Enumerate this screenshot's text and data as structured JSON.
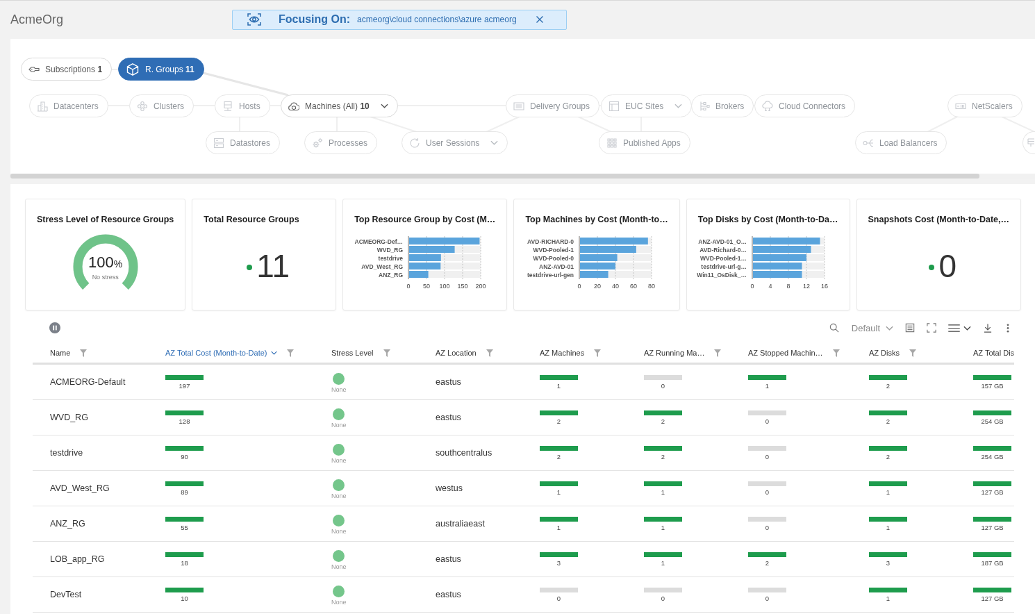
{
  "app": {
    "title": "AcmeOrg"
  },
  "focus_banner": {
    "label": "Focusing On:",
    "path": "acmeorg\\cloud connections\\azure acmeorg"
  },
  "navigator": {
    "nodes": [
      {
        "label": "Subscriptions",
        "count": "1",
        "selected": false,
        "disabled": false,
        "dropdown": false
      },
      {
        "label": "R. Groups",
        "count": "11",
        "selected": true,
        "disabled": false,
        "dropdown": false
      },
      {
        "label": "Datacenters",
        "selected": false,
        "disabled": true,
        "dropdown": false
      },
      {
        "label": "Clusters",
        "selected": false,
        "disabled": true,
        "dropdown": false
      },
      {
        "label": "Hosts",
        "selected": false,
        "disabled": true,
        "dropdown": false
      },
      {
        "label": "Machines (All)",
        "count": "10",
        "selected": false,
        "disabled": false,
        "dropdown": true
      },
      {
        "label": "Delivery Groups",
        "selected": false,
        "disabled": true,
        "dropdown": false
      },
      {
        "label": "EUC Sites",
        "selected": false,
        "disabled": true,
        "dropdown": true
      },
      {
        "label": "Brokers",
        "selected": false,
        "disabled": true,
        "dropdown": false
      },
      {
        "label": "Cloud Connectors",
        "selected": false,
        "disabled": true,
        "dropdown": false
      },
      {
        "label": "NetScalers",
        "selected": false,
        "disabled": true,
        "dropdown": false
      },
      {
        "label": "Datastores",
        "selected": false,
        "disabled": true,
        "dropdown": false
      },
      {
        "label": "Processes",
        "selected": false,
        "disabled": true,
        "dropdown": false
      },
      {
        "label": "User Sessions",
        "selected": false,
        "disabled": true,
        "dropdown": true
      },
      {
        "label": "Published Apps",
        "selected": false,
        "disabled": true,
        "dropdown": false
      },
      {
        "label": "Load Balancers",
        "selected": false,
        "disabled": true,
        "dropdown": false
      }
    ]
  },
  "kpi_cards": [
    {
      "kind": "gauge",
      "title": "Stress Level of Resource Groups",
      "value": "100",
      "unit": "%",
      "caption": "No stress"
    },
    {
      "kind": "number",
      "title": "Total Resource Groups",
      "value": "11"
    },
    {
      "kind": "chart",
      "title": "Top Resource Group by Cost (M…",
      "chart_data": {
        "type": "bar",
        "orientation": "horizontal",
        "grid": true,
        "categories": [
          "ACMEORG-Def…",
          "WVD_RG",
          "testdrive",
          "AVD_West_RG",
          "ANZ_RG"
        ],
        "values": [
          197,
          128,
          90,
          89,
          55
        ],
        "xlim": [
          0,
          200
        ],
        "xticks": [
          0,
          50,
          100,
          150,
          200
        ]
      }
    },
    {
      "kind": "chart",
      "title": "Top Machines by Cost (Month-to…",
      "chart_data": {
        "type": "bar",
        "orientation": "horizontal",
        "grid": true,
        "categories": [
          "AVD-RICHARD-0",
          "WVD-Pooled-1",
          "WVD-Pooled-0",
          "ANZ-AVD-01",
          "testdrive-url-gen"
        ],
        "values": [
          76,
          63,
          42,
          40,
          32
        ],
        "xlim": [
          0,
          80
        ],
        "xticks": [
          0,
          20,
          40,
          60,
          80
        ]
      }
    },
    {
      "kind": "chart",
      "title": "Top Disks by Cost (Month-to-Da…",
      "chart_data": {
        "type": "bar",
        "orientation": "horizontal",
        "grid": true,
        "categories": [
          "ANZ-AVD-01_O…",
          "AVD-Richard-0…",
          "WVD-Pooled-1…",
          "testdrive-url-g…",
          "Win11_OsDisk_…"
        ],
        "values": [
          15,
          13,
          12,
          11,
          11
        ],
        "xlim": [
          0,
          16
        ],
        "xticks": [
          0,
          4,
          8,
          12,
          16
        ]
      }
    },
    {
      "kind": "number",
      "title": "Snapshots Cost (Month-to-Date,…",
      "value": "0"
    }
  ],
  "table_toolbar": {
    "view": "Default"
  },
  "table": {
    "columns": [
      {
        "label": "Name",
        "sorted": false
      },
      {
        "label": "AZ Total Cost (Month-to-Date)",
        "sorted": true
      },
      {
        "label": "Stress Level",
        "sorted": false
      },
      {
        "label": "AZ Location",
        "sorted": false
      },
      {
        "label": "AZ Machines",
        "sorted": false
      },
      {
        "label": "AZ Running Ma…",
        "sorted": false
      },
      {
        "label": "AZ Stopped Machin…",
        "sorted": false
      },
      {
        "label": "AZ Disks",
        "sorted": false
      },
      {
        "label": "AZ Total Dis",
        "sorted": false
      }
    ],
    "rows": [
      {
        "cells": [
          {
            "kind": "text",
            "value": "ACMEORG-Default"
          },
          {
            "kind": "bar",
            "value": "197",
            "color": "#1e9c4d"
          },
          {
            "kind": "status",
            "label": "None",
            "color": "#74c68b"
          },
          {
            "kind": "text",
            "value": "eastus"
          },
          {
            "kind": "bar",
            "value": "1",
            "color": "#1e9c4d"
          },
          {
            "kind": "bar",
            "value": "0",
            "color": "#dcdcdc"
          },
          {
            "kind": "bar",
            "value": "1",
            "color": "#1e9c4d"
          },
          {
            "kind": "bar",
            "value": "2",
            "color": "#1e9c4d"
          },
          {
            "kind": "bar",
            "value": "157 GB",
            "color": "#1e9c4d"
          }
        ]
      },
      {
        "cells": [
          {
            "kind": "text",
            "value": "WVD_RG"
          },
          {
            "kind": "bar",
            "value": "128",
            "color": "#1e9c4d"
          },
          {
            "kind": "status",
            "label": "None",
            "color": "#74c68b"
          },
          {
            "kind": "text",
            "value": "eastus"
          },
          {
            "kind": "bar",
            "value": "2",
            "color": "#1e9c4d"
          },
          {
            "kind": "bar",
            "value": "2",
            "color": "#1e9c4d"
          },
          {
            "kind": "bar",
            "value": "0",
            "color": "#dcdcdc"
          },
          {
            "kind": "bar",
            "value": "2",
            "color": "#1e9c4d"
          },
          {
            "kind": "bar",
            "value": "254 GB",
            "color": "#1e9c4d"
          }
        ]
      },
      {
        "cells": [
          {
            "kind": "text",
            "value": "testdrive"
          },
          {
            "kind": "bar",
            "value": "90",
            "color": "#1e9c4d"
          },
          {
            "kind": "status",
            "label": "None",
            "color": "#74c68b"
          },
          {
            "kind": "text",
            "value": "southcentralus"
          },
          {
            "kind": "bar",
            "value": "2",
            "color": "#1e9c4d"
          },
          {
            "kind": "bar",
            "value": "2",
            "color": "#1e9c4d"
          },
          {
            "kind": "bar",
            "value": "0",
            "color": "#dcdcdc"
          },
          {
            "kind": "bar",
            "value": "2",
            "color": "#1e9c4d"
          },
          {
            "kind": "bar",
            "value": "254 GB",
            "color": "#1e9c4d"
          }
        ]
      },
      {
        "cells": [
          {
            "kind": "text",
            "value": "AVD_West_RG"
          },
          {
            "kind": "bar",
            "value": "89",
            "color": "#1e9c4d"
          },
          {
            "kind": "status",
            "label": "None",
            "color": "#74c68b"
          },
          {
            "kind": "text",
            "value": "westus"
          },
          {
            "kind": "bar",
            "value": "1",
            "color": "#1e9c4d"
          },
          {
            "kind": "bar",
            "value": "1",
            "color": "#1e9c4d"
          },
          {
            "kind": "bar",
            "value": "0",
            "color": "#dcdcdc"
          },
          {
            "kind": "bar",
            "value": "1",
            "color": "#1e9c4d"
          },
          {
            "kind": "bar",
            "value": "127 GB",
            "color": "#1e9c4d"
          }
        ]
      },
      {
        "cells": [
          {
            "kind": "text",
            "value": "ANZ_RG"
          },
          {
            "kind": "bar",
            "value": "55",
            "color": "#1e9c4d"
          },
          {
            "kind": "status",
            "label": "None",
            "color": "#74c68b"
          },
          {
            "kind": "text",
            "value": "australiaeast"
          },
          {
            "kind": "bar",
            "value": "1",
            "color": "#1e9c4d"
          },
          {
            "kind": "bar",
            "value": "1",
            "color": "#1e9c4d"
          },
          {
            "kind": "bar",
            "value": "0",
            "color": "#dcdcdc"
          },
          {
            "kind": "bar",
            "value": "1",
            "color": "#1e9c4d"
          },
          {
            "kind": "bar",
            "value": "127 GB",
            "color": "#1e9c4d"
          }
        ]
      },
      {
        "cells": [
          {
            "kind": "text",
            "value": "LOB_app_RG"
          },
          {
            "kind": "bar",
            "value": "18",
            "color": "#1e9c4d"
          },
          {
            "kind": "status",
            "label": "None",
            "color": "#74c68b"
          },
          {
            "kind": "text",
            "value": "eastus"
          },
          {
            "kind": "bar",
            "value": "3",
            "color": "#1e9c4d"
          },
          {
            "kind": "bar",
            "value": "1",
            "color": "#1e9c4d"
          },
          {
            "kind": "bar",
            "value": "2",
            "color": "#1e9c4d"
          },
          {
            "kind": "bar",
            "value": "3",
            "color": "#1e9c4d"
          },
          {
            "kind": "bar",
            "value": "187 GB",
            "color": "#1e9c4d"
          }
        ]
      },
      {
        "cells": [
          {
            "kind": "text",
            "value": "DevTest"
          },
          {
            "kind": "bar",
            "value": "10",
            "color": "#1e9c4d"
          },
          {
            "kind": "status",
            "label": "None",
            "color": "#74c68b"
          },
          {
            "kind": "text",
            "value": "eastus"
          },
          {
            "kind": "bar",
            "value": "0",
            "color": "#dcdcdc"
          },
          {
            "kind": "bar",
            "value": "0",
            "color": "#dcdcdc"
          },
          {
            "kind": "bar",
            "value": "0",
            "color": "#dcdcdc"
          },
          {
            "kind": "bar",
            "value": "1",
            "color": "#1e9c4d"
          },
          {
            "kind": "bar",
            "value": "127 GB",
            "color": "#1e9c4d"
          }
        ]
      }
    ]
  }
}
